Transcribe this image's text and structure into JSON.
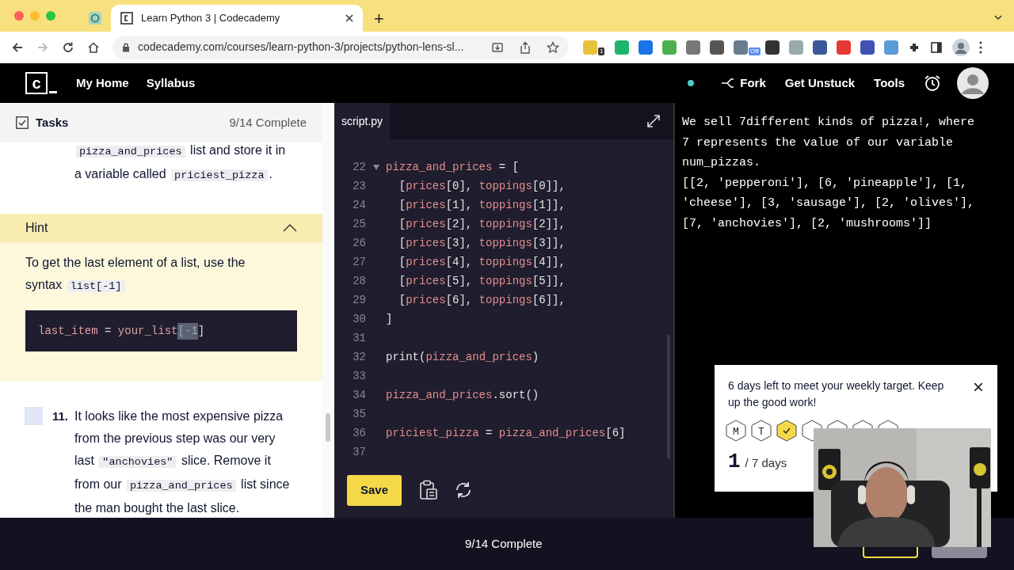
{
  "browser": {
    "tabs": [
      {
        "selected": false
      },
      {
        "title": "Learn Python 3 | Codecademy",
        "selected": true
      }
    ],
    "new_tab": "+",
    "url": "codecademy.com/courses/learn-python-3/projects/python-lens-sl...",
    "extensions": [
      {
        "kind": "badged",
        "badge": "1"
      },
      {
        "kind": "plain"
      },
      {
        "kind": "plain"
      },
      {
        "kind": "plain"
      },
      {
        "kind": "plain"
      },
      {
        "kind": "plain"
      },
      {
        "kind": "badged",
        "badge": "Off"
      },
      {
        "kind": "plain"
      },
      {
        "kind": "plain"
      },
      {
        "kind": "plain"
      },
      {
        "kind": "plain"
      },
      {
        "kind": "plain"
      },
      {
        "kind": "plain"
      }
    ]
  },
  "header": {
    "logo": "c",
    "nav": [
      {
        "label": "My Home"
      },
      {
        "label": "Syllabus"
      }
    ],
    "actions": [
      {
        "label": "Fork",
        "kind": "fork"
      },
      {
        "label": "Get Unstuck",
        "kind": "plain"
      },
      {
        "label": "Tools",
        "kind": "plain"
      }
    ]
  },
  "tasks": {
    "title": "Tasks",
    "progress": "9/14 Complete",
    "intro": [
      {
        "t": "pizza_and_prices",
        "kind": "code"
      },
      {
        "t": " list and store it in a variable called ",
        "kind": "text"
      },
      {
        "t": "priciest_pizza",
        "kind": "code"
      },
      {
        "t": ".",
        "kind": "text"
      }
    ],
    "hint": {
      "title": "Hint",
      "expanded": true,
      "text": [
        {
          "t": "To get the last element of a list, use the syntax ",
          "kind": "text"
        },
        {
          "t": "list[-1]",
          "kind": "code"
        }
      ],
      "code": [
        {
          "t": "last_item",
          "selected": false
        },
        {
          "t": " = ",
          "selected": false
        },
        {
          "t": "your_list",
          "selected": false
        },
        {
          "t": "[-1",
          "selected": true
        },
        {
          "t": "]",
          "selected": false
        }
      ]
    },
    "task": {
      "number": "11.",
      "checked": false,
      "text": [
        {
          "t": "It looks like the most expensive pizza from the previous step was our very last ",
          "kind": "text"
        },
        {
          "t": "\"anchovies\"",
          "kind": "code"
        },
        {
          "t": " slice. Remove it from our ",
          "kind": "text"
        },
        {
          "t": "pizza_and_prices",
          "kind": "code"
        },
        {
          "t": " list since the man bought the last slice.",
          "kind": "text"
        }
      ]
    }
  },
  "editor": {
    "file": "script.py",
    "lines": [
      {
        "n": "22",
        "fold": true,
        "tokens": [
          {
            "t": "pizza_and_prices",
            "kind": "name"
          },
          {
            "t": " = [",
            "kind": "plain"
          }
        ]
      },
      {
        "n": "23",
        "fold": false,
        "tokens": [
          {
            "t": "  [",
            "kind": "plain"
          },
          {
            "t": "prices",
            "kind": "name"
          },
          {
            "t": "[0], ",
            "kind": "plain"
          },
          {
            "t": "toppings",
            "kind": "name"
          },
          {
            "t": "[0]],",
            "kind": "plain"
          }
        ]
      },
      {
        "n": "24",
        "fold": false,
        "tokens": [
          {
            "t": "  [",
            "kind": "plain"
          },
          {
            "t": "prices",
            "kind": "name"
          },
          {
            "t": "[1], ",
            "kind": "plain"
          },
          {
            "t": "toppings",
            "kind": "name"
          },
          {
            "t": "[1]],",
            "kind": "plain"
          }
        ]
      },
      {
        "n": "25",
        "fold": false,
        "tokens": [
          {
            "t": "  [",
            "kind": "plain"
          },
          {
            "t": "prices",
            "kind": "name"
          },
          {
            "t": "[2], ",
            "kind": "plain"
          },
          {
            "t": "toppings",
            "kind": "name"
          },
          {
            "t": "[2]],",
            "kind": "plain"
          }
        ]
      },
      {
        "n": "26",
        "fold": false,
        "tokens": [
          {
            "t": "  [",
            "kind": "plain"
          },
          {
            "t": "prices",
            "kind": "name"
          },
          {
            "t": "[3], ",
            "kind": "plain"
          },
          {
            "t": "toppings",
            "kind": "name"
          },
          {
            "t": "[3]],",
            "kind": "plain"
          }
        ]
      },
      {
        "n": "27",
        "fold": false,
        "tokens": [
          {
            "t": "  [",
            "kind": "plain"
          },
          {
            "t": "prices",
            "kind": "name"
          },
          {
            "t": "[4], ",
            "kind": "plain"
          },
          {
            "t": "toppings",
            "kind": "name"
          },
          {
            "t": "[4]],",
            "kind": "plain"
          }
        ]
      },
      {
        "n": "28",
        "fold": false,
        "tokens": [
          {
            "t": "  [",
            "kind": "plain"
          },
          {
            "t": "prices",
            "kind": "name"
          },
          {
            "t": "[5], ",
            "kind": "plain"
          },
          {
            "t": "toppings",
            "kind": "name"
          },
          {
            "t": "[5]],",
            "kind": "plain"
          }
        ]
      },
      {
        "n": "29",
        "fold": false,
        "tokens": [
          {
            "t": "  [",
            "kind": "plain"
          },
          {
            "t": "prices",
            "kind": "name"
          },
          {
            "t": "[6], ",
            "kind": "plain"
          },
          {
            "t": "toppings",
            "kind": "name"
          },
          {
            "t": "[6]],",
            "kind": "plain"
          }
        ]
      },
      {
        "n": "30",
        "fold": false,
        "tokens": [
          {
            "t": "]",
            "kind": "plain"
          }
        ]
      },
      {
        "n": "31",
        "fold": false
      },
      {
        "n": "32",
        "fold": false,
        "tokens": [
          {
            "t": "print(",
            "kind": "plain"
          },
          {
            "t": "pizza_and_prices",
            "kind": "name"
          },
          {
            "t": ")",
            "kind": "plain"
          }
        ]
      },
      {
        "n": "33",
        "fold": false
      },
      {
        "n": "34",
        "fold": false,
        "tokens": [
          {
            "t": "pizza_and_prices",
            "kind": "name"
          },
          {
            "t": ".sort()",
            "kind": "plain"
          }
        ]
      },
      {
        "n": "35",
        "fold": false
      },
      {
        "n": "36",
        "fold": false,
        "tokens": [
          {
            "t": "priciest_pizza",
            "kind": "name"
          },
          {
            "t": " = ",
            "kind": "plain"
          },
          {
            "t": "pizza_and_prices",
            "kind": "name"
          },
          {
            "t": "[6]",
            "kind": "plain"
          }
        ]
      },
      {
        "n": "37",
        "fold": false
      }
    ],
    "save": "Save"
  },
  "output": [
    "We sell 7different kinds of pizza!, where 7 represents the value of our variable num_pizzas.",
    "[[2, 'pepperoni'], [6, 'pineapple'], [1, 'cheese'], [3, 'sausage'], [2, 'olives'], [7, 'anchovies'], [2, 'mushrooms']]"
  ],
  "streak": {
    "message": "6 days left to meet your weekly target. Keep up the good work!",
    "close": "×",
    "days": [
      {
        "label": "M",
        "done": false
      },
      {
        "label": "T",
        "done": false
      },
      {
        "done": true
      },
      {
        "done": false
      },
      {
        "done": false
      },
      {
        "done": false
      },
      {
        "done": false
      }
    ],
    "count": "1",
    "total": "/ 7 days"
  },
  "footer": {
    "progress": "9/14 Complete"
  }
}
